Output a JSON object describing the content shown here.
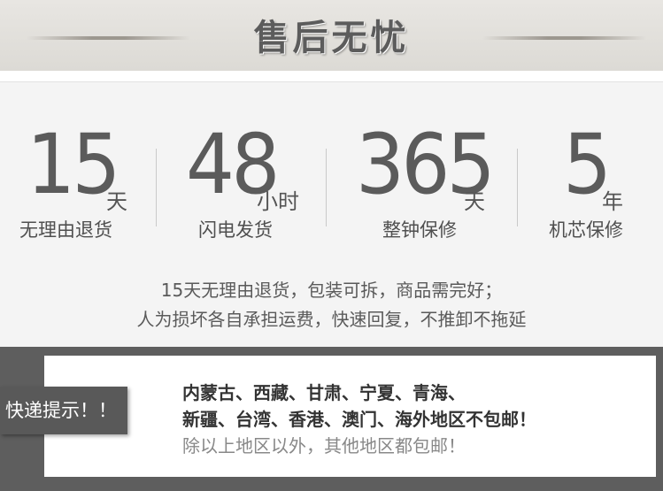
{
  "header": {
    "title": "售后无忧"
  },
  "stats": [
    {
      "number": "15",
      "unit": "天",
      "label": "无理由退货"
    },
    {
      "number": "48",
      "unit": "小时",
      "label": "闪电发货"
    },
    {
      "number": "365",
      "unit": "天",
      "label": "整钟保修"
    },
    {
      "number": "5",
      "unit": "年",
      "label": "机芯保修"
    }
  ],
  "policy": {
    "line1": "15天无理由退货，包装可拆，商品需完好；",
    "line2": "人为损坏各自承担运费，快速回复，不推卸不拖延"
  },
  "notice": {
    "tag": "快递提示！！",
    "line1": "内蒙古、西藏、甘肃、宁夏、青海、",
    "line2": "新疆、台湾、香港、澳门、海外地区不包邮！",
    "line3": "除以上地区以外，其他地区都包邮！"
  }
}
